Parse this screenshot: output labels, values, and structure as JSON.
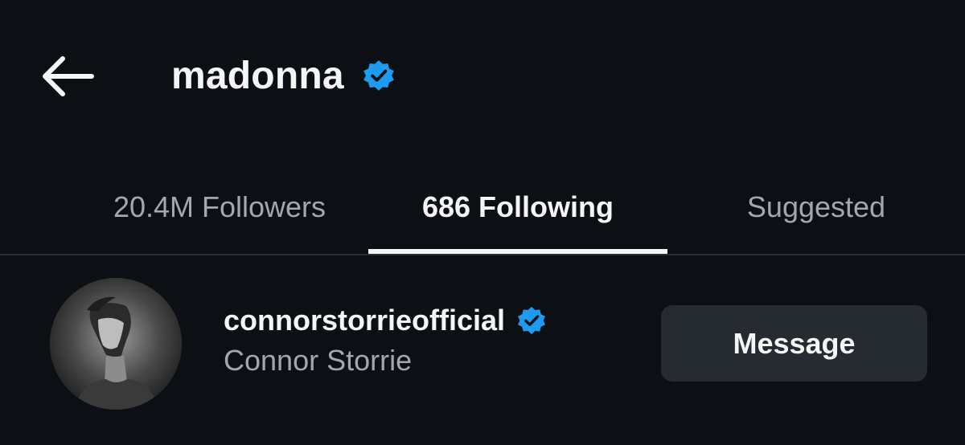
{
  "header": {
    "title": "madonna",
    "back_icon": "arrow-left-icon",
    "verified_icon": "verified-badge-icon"
  },
  "tabs": [
    {
      "label": "20.4M Followers",
      "selected": false
    },
    {
      "label": "686 Following",
      "selected": true
    },
    {
      "label": "Suggested",
      "selected": false
    }
  ],
  "list": {
    "items": [
      {
        "username": "connorstorrieofficial",
        "full_name": "Connor Storrie",
        "verified": true,
        "action_label": "Message"
      }
    ]
  },
  "colors": {
    "background": "#0c0f14",
    "verified": "#1d9bf0",
    "muted_text": "#a3a7b1",
    "button_bg": "#262a31"
  }
}
